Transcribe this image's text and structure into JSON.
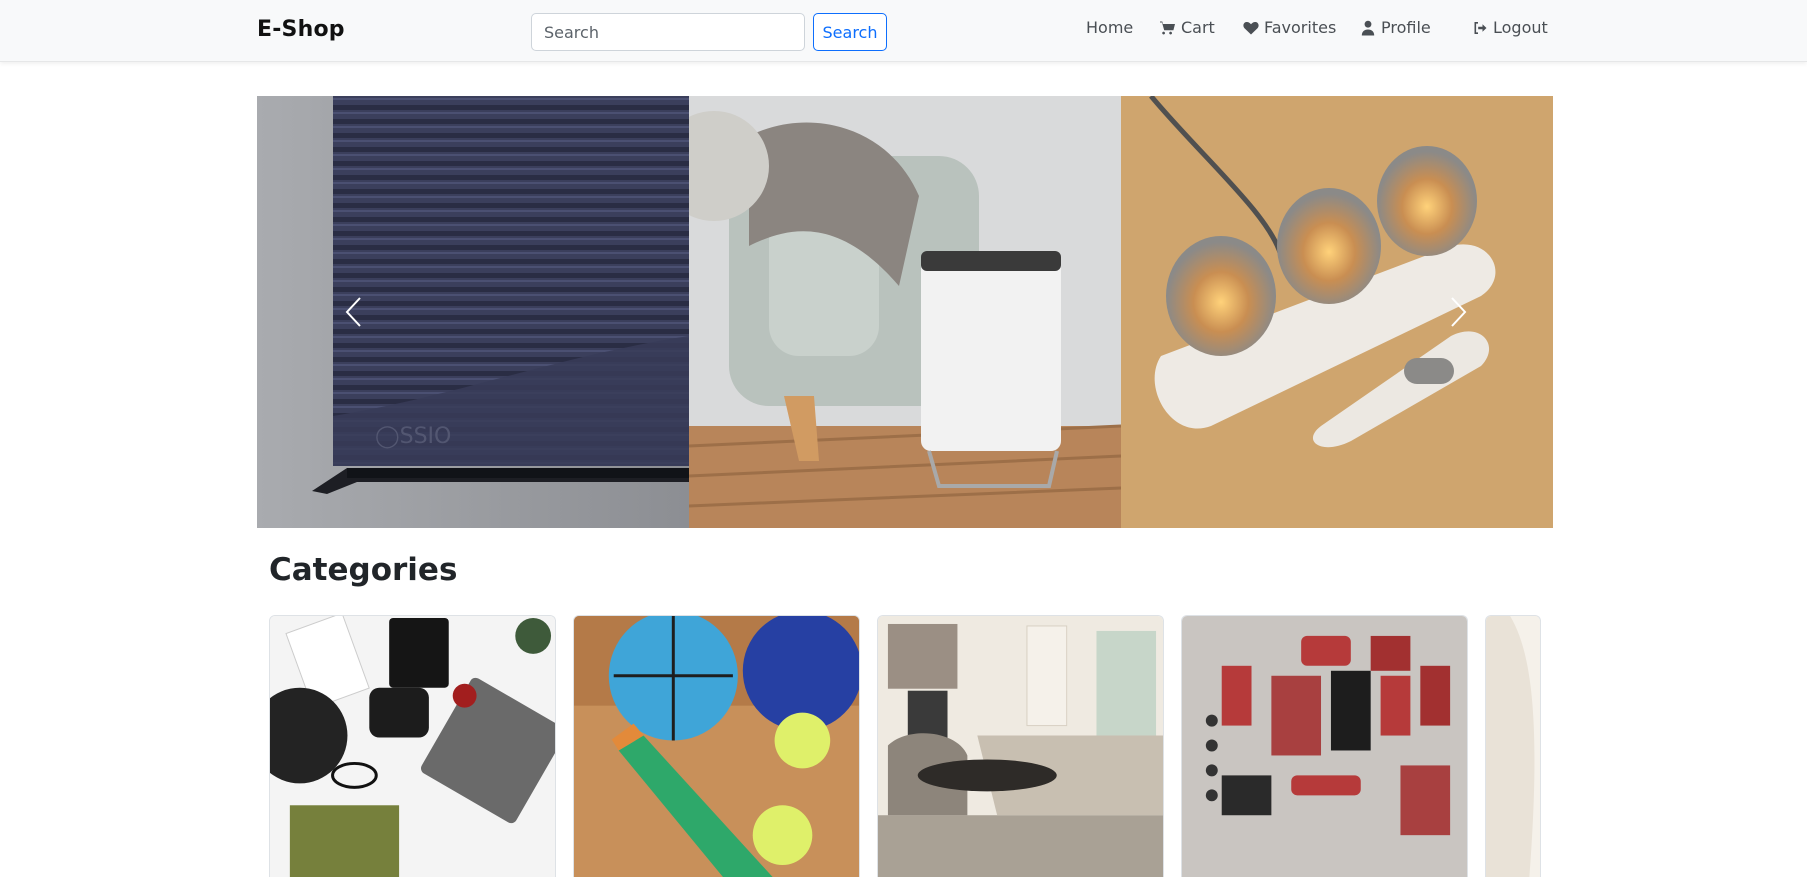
{
  "navbar": {
    "brand": "E-Shop",
    "search": {
      "placeholder": "Search",
      "button_label": "Search"
    },
    "links": {
      "home": "Home",
      "cart": "Cart",
      "favorites": "Favorites",
      "profile": "Profile",
      "logout": "Logout"
    },
    "icons": {
      "cart": "cart-icon",
      "favorites": "heart-icon",
      "profile": "user-icon",
      "logout": "sign-out-icon"
    }
  },
  "carousel": {
    "slides": [
      {
        "name": "space-heater-image"
      },
      {
        "name": "air-purifier-sofa-image"
      },
      {
        "name": "candle-lamps-image"
      }
    ],
    "prev_icon": "chevron-left-icon",
    "next_icon": "chevron-right-icon"
  },
  "categories": {
    "title": "Categories",
    "cards": [
      {
        "name": "electronics-flatlay-image"
      },
      {
        "name": "sports-balls-image"
      },
      {
        "name": "living-room-image"
      },
      {
        "name": "car-parts-image"
      },
      {
        "name": "fashion-image"
      }
    ]
  },
  "colors": {
    "accent": "#0d6efd",
    "navbar_bg": "#f8f9fa",
    "text": "#212529"
  }
}
